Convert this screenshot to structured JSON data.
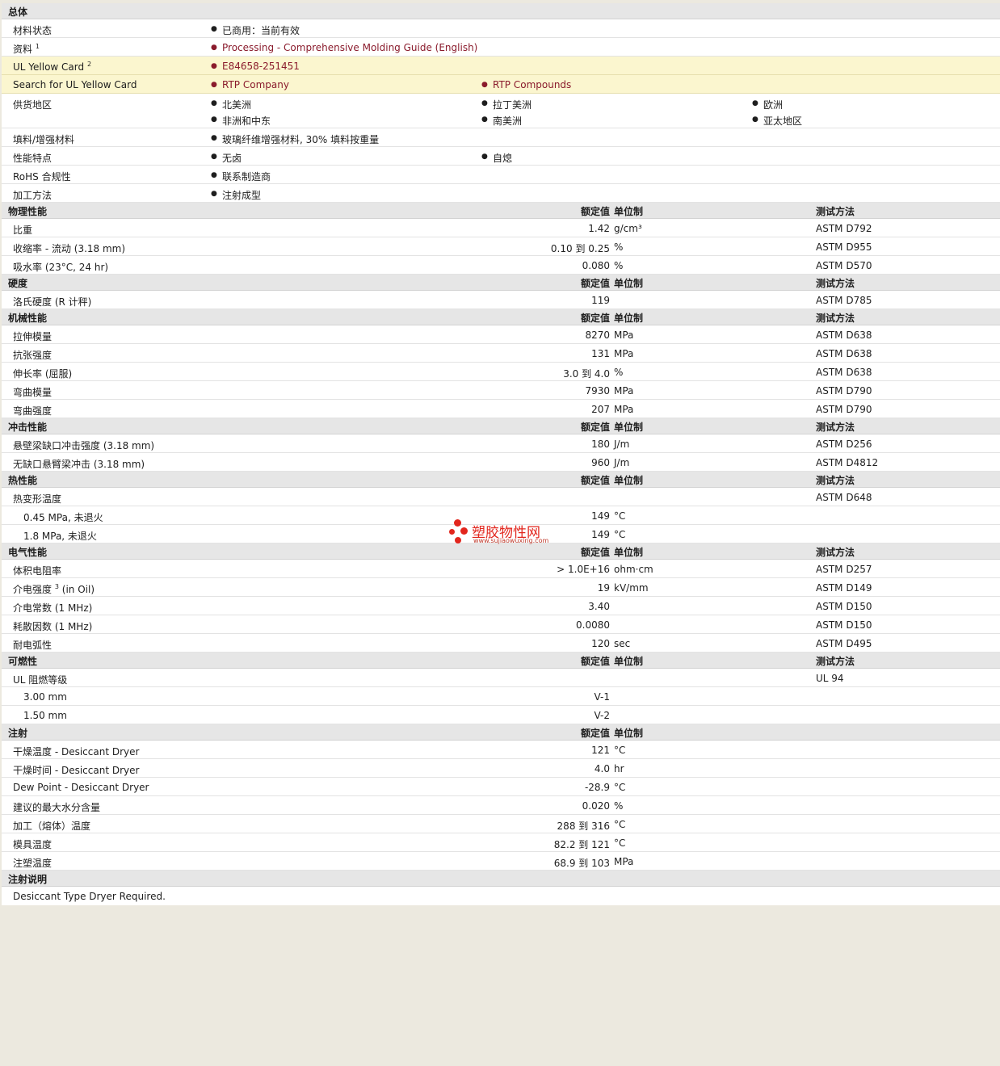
{
  "general": {
    "title": "总体",
    "status_label": "材料状态",
    "status_value": "已商用：当前有效",
    "docs_label": "资料",
    "docs_sup": "1",
    "docs_link": "Processing - Comprehensive Molding Guide (English)",
    "ulcard_label": "UL Yellow Card",
    "ulcard_sup": "2",
    "ulcard_link": "E84658-251451",
    "search_label": "Search for UL Yellow Card",
    "search_link1": "RTP Company",
    "search_link2": "RTP Compounds",
    "supply_label": "供货地区",
    "supply_regions": [
      "北美洲",
      "拉丁美洲",
      "欧洲",
      "非洲和中东",
      "南美洲",
      "亚太地区"
    ],
    "filler_label": "填料/增强材料",
    "filler_value": "玻璃纤维增强材料, 30% 填料按重量",
    "features_label": "性能特点",
    "features": [
      "无卤",
      "自熄"
    ],
    "rohs_label": "RoHS 合规性",
    "rohs_value": "联系制造商",
    "process_label": "加工方法",
    "process_value": "注射成型"
  },
  "headers": {
    "nominal": "额定值",
    "unit": "单位制",
    "method": "测试方法"
  },
  "physical": {
    "title": "物理性能",
    "rows": [
      {
        "label": "比重",
        "value": "1.42",
        "unit": "g/cm³",
        "method": "ASTM D792"
      },
      {
        "label": "收缩率  - 流动  (3.18 mm)",
        "value": "0.10 到  0.25",
        "unit": "%",
        "method": "ASTM D955"
      },
      {
        "label": "吸水率  (23°C, 24 hr)",
        "value": "0.080",
        "unit": "%",
        "method": "ASTM D570"
      }
    ]
  },
  "hardness": {
    "title": "硬度",
    "rows": [
      {
        "label": "洛氏硬度  (R 计秤)",
        "value": "119",
        "unit": "",
        "method": "ASTM D785"
      }
    ]
  },
  "mechanical": {
    "title": "机械性能",
    "rows": [
      {
        "label": "拉伸模量",
        "value": "8270",
        "unit": "MPa",
        "method": "ASTM D638"
      },
      {
        "label": "抗张强度",
        "value": "131",
        "unit": "MPa",
        "method": "ASTM D638"
      },
      {
        "label": "伸长率  (屈服)",
        "value": "3.0 到  4.0",
        "unit": "%",
        "method": "ASTM D638"
      },
      {
        "label": "弯曲模量",
        "value": "7930",
        "unit": "MPa",
        "method": "ASTM D790"
      },
      {
        "label": "弯曲强度",
        "value": "207",
        "unit": "MPa",
        "method": "ASTM D790"
      }
    ]
  },
  "impact": {
    "title": "冲击性能",
    "rows": [
      {
        "label": "悬壁梁缺口冲击强度  (3.18 mm)",
        "value": "180",
        "unit": "J/m",
        "method": "ASTM D256"
      },
      {
        "label": "无缺口悬臂梁冲击  (3.18 mm)",
        "value": "960",
        "unit": "J/m",
        "method": "ASTM D4812"
      }
    ]
  },
  "thermal": {
    "title": "热性能",
    "hdt_label": "热变形温度",
    "hdt_method": "ASTM D648",
    "rows": [
      {
        "label": "0.45 MPa, 未退火",
        "value": "149",
        "unit": "°C"
      },
      {
        "label": "1.8 MPa, 未退火",
        "value": "149",
        "unit": "°C"
      }
    ]
  },
  "electrical": {
    "title": "电气性能",
    "r1": {
      "label": "体积电阻率",
      "value": "> 1.0E+16",
      "unit": "ohm·cm",
      "method": "ASTM D257"
    },
    "r2": {
      "label": "介电强度",
      "sup": "3",
      "suffix": "(in Oil)",
      "value": "19",
      "unit": "kV/mm",
      "method": "ASTM D149"
    },
    "r3": {
      "label": "介电常数  (1 MHz)",
      "value": "3.40",
      "unit": "",
      "method": "ASTM D150"
    },
    "r4": {
      "label": "耗散因数  (1 MHz)",
      "value": "0.0080",
      "unit": "",
      "method": "ASTM D150"
    },
    "r5": {
      "label": "耐电弧性",
      "value": "120",
      "unit": "sec",
      "method": "ASTM D495"
    }
  },
  "flammability": {
    "title": "可燃性",
    "ul_label": "UL 阻燃等级",
    "ul_method": "UL 94",
    "rows": [
      {
        "label": "3.00 mm",
        "value": "V-1"
      },
      {
        "label": "1.50 mm",
        "value": "V-2"
      }
    ]
  },
  "injection": {
    "title": "注射",
    "rows": [
      {
        "label": "干燥温度  - Desiccant Dryer",
        "value": "121",
        "unit": "°C"
      },
      {
        "label": "干燥时间  - Desiccant Dryer",
        "value": "4.0",
        "unit": "hr"
      },
      {
        "label": "Dew Point - Desiccant Dryer",
        "value": "-28.9",
        "unit": "°C"
      },
      {
        "label": "建议的最大水分含量",
        "value": "0.020",
        "unit": "%"
      },
      {
        "label": "加工（熔体）温度",
        "value": "288 到  316",
        "unit": "°C"
      },
      {
        "label": "模具温度",
        "value": "82.2 到  121",
        "unit": "°C"
      },
      {
        "label": "注塑温度",
        "value": "68.9 到  103",
        "unit": "MPa"
      }
    ]
  },
  "notes": {
    "title": "注射说明",
    "text": "Desiccant Type Dryer Required."
  },
  "watermark": {
    "text": "塑胶物性网",
    "url": "www.sujiaowuxing.com",
    "color": "#e2261d"
  }
}
